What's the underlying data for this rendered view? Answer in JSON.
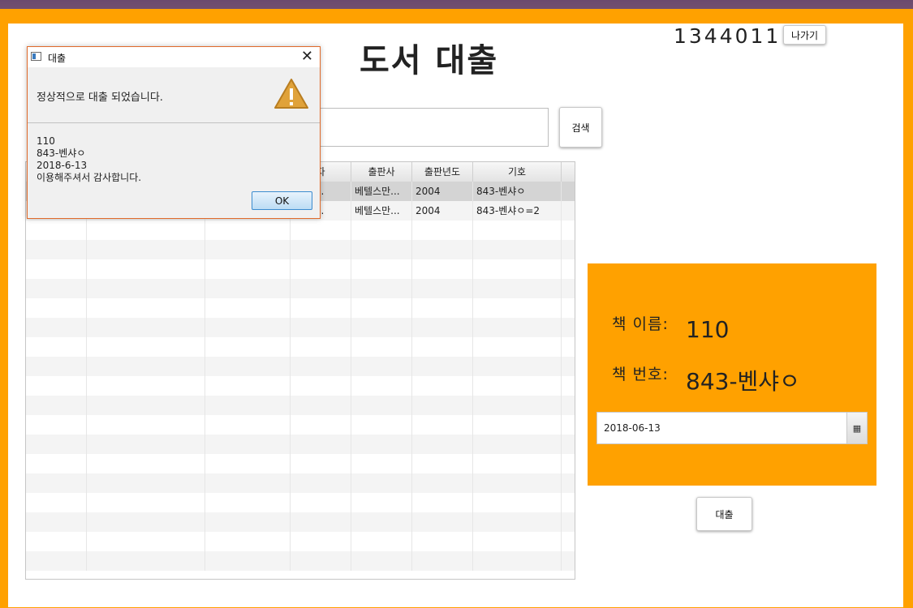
{
  "page": {
    "title": "도서 대출",
    "user_id": "1344011",
    "exit_button": "나가기",
    "search_button": "검색",
    "search_value": "",
    "loan_button": "대출"
  },
  "table": {
    "columns": [
      "자",
      "출판사",
      "출판년도",
      "기호"
    ],
    "rows": [
      [
        "벤샤 ...",
        "베텔스만...",
        "2004",
        "843-벤샤ㅇ"
      ],
      [
        "벤샤 ...",
        "베텔스만...",
        "2004",
        "843-벤샤ㅇ=2"
      ]
    ]
  },
  "panel": {
    "book_name_label": "책 이름:",
    "book_name_value": "110",
    "book_number_label": "책 번호:",
    "book_number_value": "843-벤샤ㅇ",
    "date_value": "2018-06-13",
    "calendar_icon": "calendar-icon"
  },
  "dialog": {
    "title": "대출",
    "header_text": "정상적으로 대출 되었습니다.",
    "body_lines": [
      "110",
      "843-벤샤ㅇ",
      "2018-6-13",
      "이용해주셔서 감사합니다."
    ],
    "ok_button": "OK",
    "close_glyph": "✕",
    "warning_icon": "warning-icon"
  },
  "colors": {
    "accent": "#ffa100",
    "dialog_border": "#e06a2a",
    "selected_row": "#d4d4d4"
  }
}
